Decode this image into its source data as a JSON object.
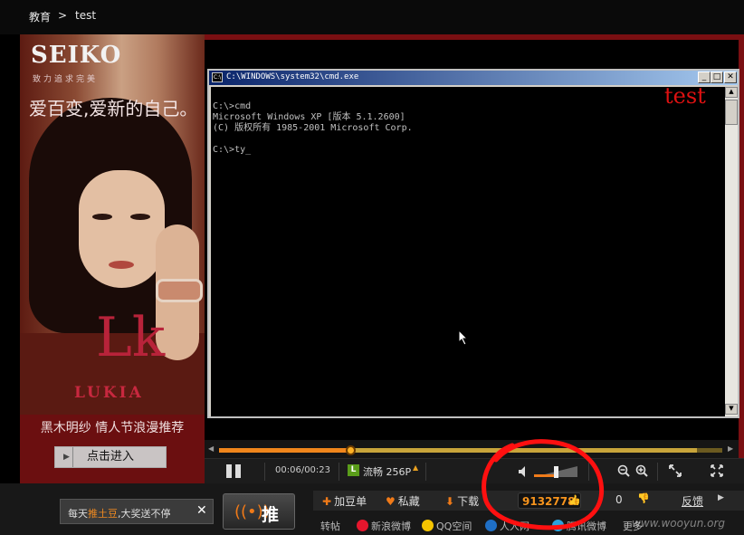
{
  "breadcrumb": {
    "home": "教育",
    "separator": ">",
    "current": "test"
  },
  "ad": {
    "brand": "SEIKO",
    "brand_sub": "致力追求完美",
    "slogan": "爱百变,爱新的自己。",
    "logo_letter": "Lk",
    "product": "LUKIA",
    "caption": "黑木明纱 情人节浪漫推荐",
    "button_label": "点击进入"
  },
  "cmd": {
    "title": "C:\\WINDOWS\\system32\\cmd.exe",
    "lines": "C:\\>cmd\nMicrosoft Windows XP [版本 5.1.2600]\n(C) 版权所有 1985-2001 Microsoft Corp.\n\nC:\\>ty_",
    "watermark": "test"
  },
  "player": {
    "time": "00:06/00:23",
    "progress": 0.26,
    "buffered": 0.95,
    "quality_badge": "L",
    "quality": "流畅 256P",
    "volume": 0.5
  },
  "bottom": {
    "notice_prefix": "每天",
    "notice_highlight": "推土豆",
    "notice_suffix": ",大奖送不停",
    "notice_close": "✕",
    "push_label": "推",
    "actions": {
      "add_list": "加豆单",
      "favorite": "私藏",
      "download": "下载"
    },
    "like_count": "9132778",
    "dislike_count": "0",
    "feedback": "反馈",
    "share_label": "转帖",
    "share_sites": [
      "新浪微博",
      "QQ空间",
      "人人网",
      "腾讯微博",
      "更多"
    ]
  },
  "site_watermark": "www.wooyun.org",
  "colors": {
    "accent": "#f07a18",
    "frame_red": "#7a0f12",
    "annotation_red": "#ff1010"
  }
}
